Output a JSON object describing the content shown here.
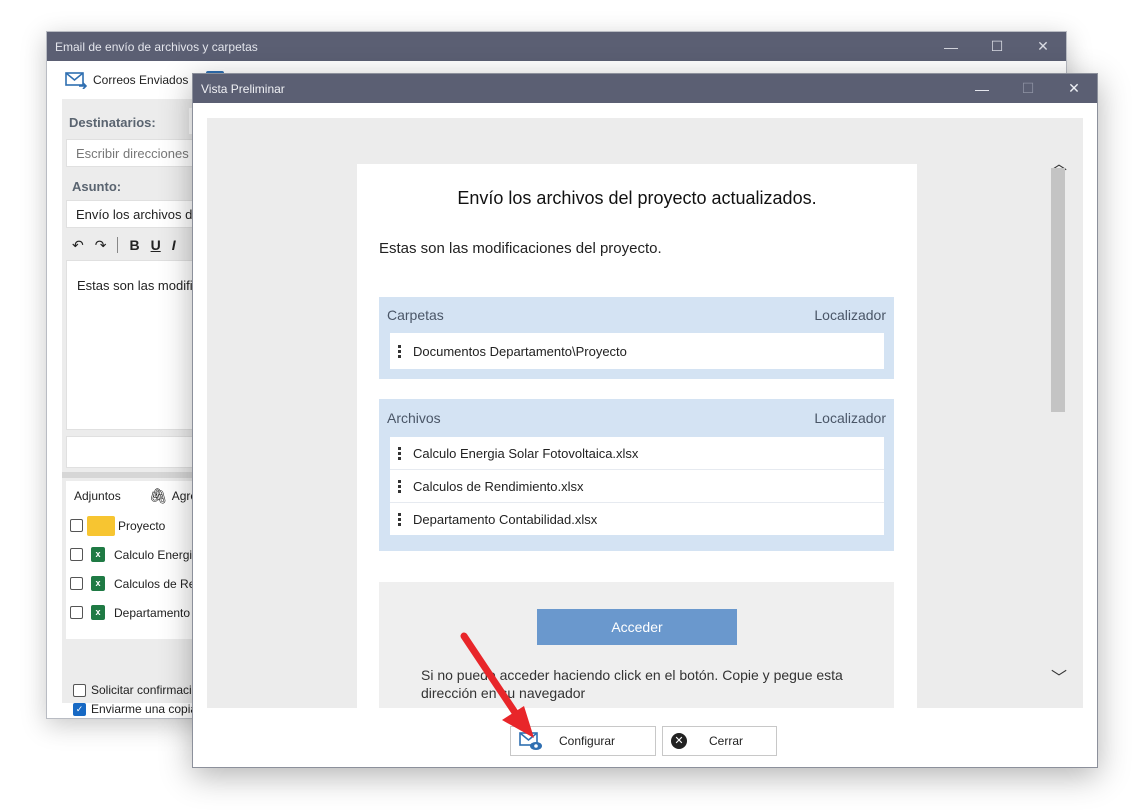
{
  "back_window": {
    "title": "Email de envío de archivos y carpetas",
    "ribbon": {
      "sent_label": "Correos Enviados"
    },
    "recipients_label": "Destinatarios:",
    "recipients_placeholder": "Escribir direcciones",
    "subject_label": "Asunto:",
    "subject_value": "Envío los archivos de",
    "format_bold": "B",
    "format_underline": "U",
    "format_italic": "I",
    "body_text": "Estas son las modifi",
    "attachments": {
      "header": "Adjuntos",
      "add_label": "Agre",
      "items": [
        "Proyecto",
        "Calculo Energi",
        "Calculos de Re",
        "Departamento"
      ]
    },
    "request_confirmation": "Solicitar confirmació",
    "send_copy": "Enviarme una copia"
  },
  "preview_window": {
    "title": "Vista Preliminar",
    "email": {
      "title": "Envío los archivos del proyecto actualizados.",
      "body": "Estas son las modificaciones del proyecto.",
      "folders_table": {
        "col1": "Carpetas",
        "col2": "Localizador",
        "rows": [
          "Documentos Departamento\\Proyecto"
        ]
      },
      "files_table": {
        "col1": "Archivos",
        "col2": "Localizador",
        "rows": [
          "Calculo Energia Solar Fotovoltaica.xlsx",
          "Calculos de Rendimiento.xlsx",
          "Departamento Contabilidad.xlsx"
        ]
      },
      "access_button": "Acceder",
      "footer_text": "Si no puede acceder haciendo click en el botón. Copie y pegue esta dirección en su navegador"
    },
    "buttons": {
      "configure": "Configurar",
      "close": "Cerrar"
    }
  },
  "colors": {
    "titlebar": "#5b5f73",
    "accent_button": "#6a98cd",
    "table_header": "#d4e3f3",
    "arrow": "#e8262a"
  }
}
